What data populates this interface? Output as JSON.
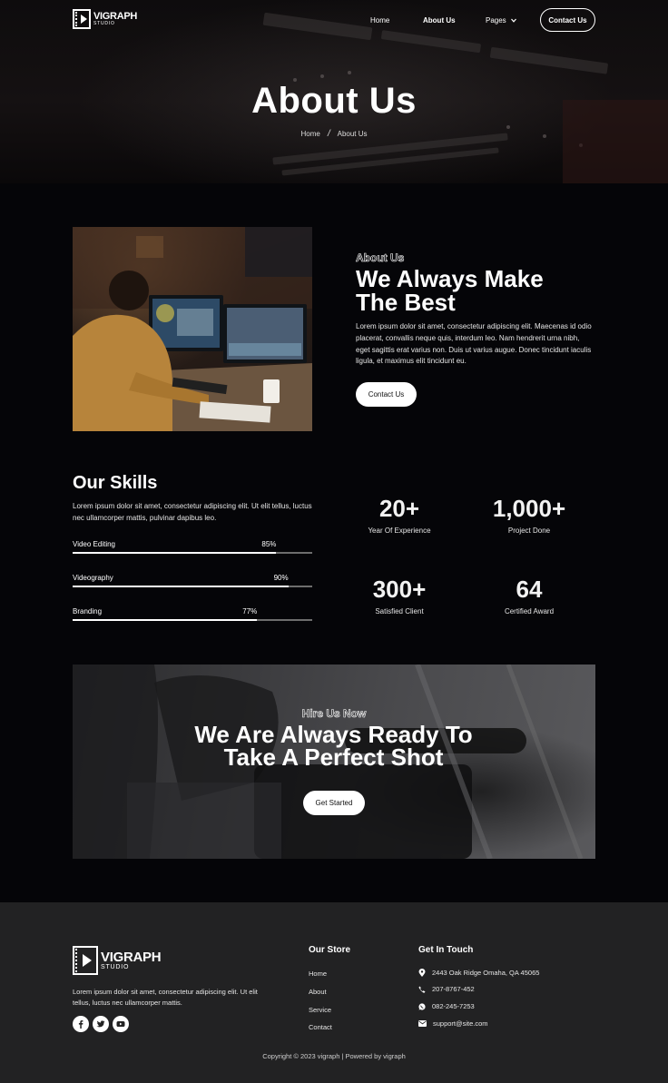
{
  "header": {
    "logo": {
      "name": "VIGRAPH",
      "sub": "STUDIO"
    },
    "nav": [
      {
        "label": "Home"
      },
      {
        "label": "About Us"
      },
      {
        "label": "Pages"
      }
    ],
    "cta_label": "Contact Us"
  },
  "hero": {
    "title": "About Us",
    "breadcrumb": {
      "home": "Home",
      "sep": "/",
      "current": "About Us"
    }
  },
  "about": {
    "eyebrow": "About Us",
    "title_line1": "We Always Make",
    "title_line2": "The Best",
    "body": "Lorem ipsum dolor sit amet, consectetur adipiscing elit. Maecenas id odio placerat, convallis neque quis, interdum leo. Nam hendrerit urna nibh, eget sagittis erat varius non. Duis ut varius augue. Donec tincidunt iaculis ligula, et maximus elit tincidunt eu.",
    "button": "Contact Us"
  },
  "skills": {
    "title": "Our Skills",
    "body": "Lorem ipsum dolor sit amet, consectetur adipiscing elit. Ut elit tellus, luctus nec ullamcorper mattis, pulvinar dapibus leo.",
    "items": [
      {
        "label": "Video Editing",
        "pct_text": "85%",
        "value": 0.85
      },
      {
        "label": "Videography",
        "pct_text": "90%",
        "value": 0.9
      },
      {
        "label": "Branding",
        "pct_text": "77%",
        "value": 0.77
      }
    ]
  },
  "stats": [
    {
      "num": "20+",
      "label": "Year Of Experience"
    },
    {
      "num": "1,000+",
      "label": "Project Done"
    },
    {
      "num": "300+",
      "label": "Satisfied Client"
    },
    {
      "num": "64",
      "label": "Certified Award"
    }
  ],
  "cta": {
    "eyebrow": "Hire Us Now",
    "title_line1": "We Are Always Ready To",
    "title_line2": "Take A Perfect Shot",
    "button": "Get Started"
  },
  "footer": {
    "logo": {
      "name": "VIGRAPH",
      "sub": "STUDIO"
    },
    "about": "Lorem ipsum dolor sit amet, consectetur adipiscing elit. Ut elit tellus, luctus nec ullamcorper mattis.",
    "social_icons": [
      "facebook-icon",
      "twitter-icon",
      "youtube-icon"
    ],
    "store_title": "Our Store",
    "store_links": [
      "Home",
      "About",
      "Service",
      "Contact"
    ],
    "touch_title": "Get In Touch",
    "contacts": [
      {
        "icon": "map-pin-icon",
        "text": "2443 Oak Ridge Omaha, QA 45065"
      },
      {
        "icon": "phone-icon",
        "text": "207-8767-452"
      },
      {
        "icon": "whatsapp-icon",
        "text": "082-245-7253"
      },
      {
        "icon": "envelope-icon",
        "text": "support@site.com"
      }
    ],
    "copyright": "Copyright © 2023 vigraph | Powered by vigraph"
  }
}
